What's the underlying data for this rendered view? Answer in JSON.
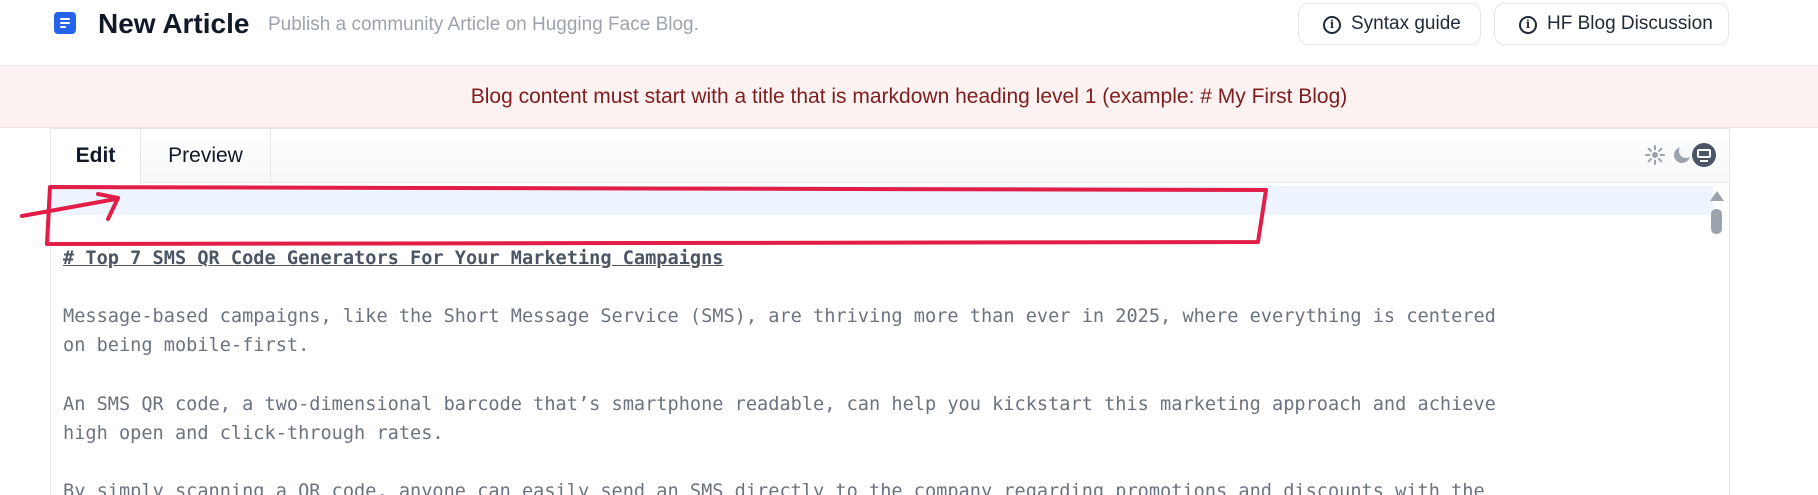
{
  "header": {
    "title": "New Article",
    "subtitle": "Publish a community Article on Hugging Face Blog.",
    "buttons": {
      "syntax_guide": "Syntax guide",
      "discussion": "HF Blog Discussion"
    }
  },
  "banner": {
    "message": "Blog content must start with a title that is markdown heading level 1 (example: # My First Blog)"
  },
  "editor": {
    "tabs": [
      "Edit",
      "Preview"
    ],
    "active_tab": "Edit",
    "theme_icons": [
      "sun-icon",
      "moon-icon",
      "monitor-icon"
    ],
    "lines": [
      "",
      "",
      "# Top 7 SMS QR Code Generators For Your Marketing Campaigns",
      "",
      "Message-based campaigns, like the Short Message Service (SMS), are thriving more than ever in 2025, where everything is centered",
      "on being mobile-first.",
      "",
      "An SMS QR code, a two-dimensional barcode that’s smartphone readable, can help you kickstart this marketing approach and achieve",
      "high open and click-through rates.",
      "",
      "By simply scanning a QR code, anyone can easily send an SMS directly to the company regarding promotions and discounts with the"
    ]
  },
  "colors": {
    "accent": "#2563eb",
    "banner_bg": "#fdf2f2",
    "banner_text": "#7f1d1d",
    "annotation": "#e11d48"
  }
}
